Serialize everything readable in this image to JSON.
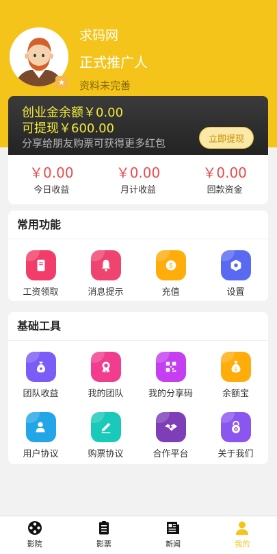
{
  "profile": {
    "site_name": "求码网",
    "role": "正式推广人",
    "note": "资料未完善"
  },
  "balance": {
    "line1": "创业金余额￥0.00",
    "line2": "可提现￥600.00",
    "note": "分享给朋友购票可获得更多红包",
    "withdraw_label": "立即提现"
  },
  "earnings": [
    {
      "value": "￥0.00",
      "label": "今日收益"
    },
    {
      "value": "￥0.00",
      "label": "月计收益"
    },
    {
      "value": "￥0.00",
      "label": "回款资金"
    }
  ],
  "common": {
    "title": "常用功能",
    "items": [
      {
        "label": "工资领取",
        "icon": "envelope-icon",
        "color": "#f23d6a"
      },
      {
        "label": "消息提示",
        "icon": "bell-icon",
        "color": "#f04470"
      },
      {
        "label": "充值",
        "icon": "coin-icon",
        "color": "#ffad0a"
      },
      {
        "label": "设置",
        "icon": "gear-icon",
        "color": "#5969f2"
      }
    ]
  },
  "tools": {
    "title": "基础工具",
    "items": [
      {
        "label": "团队收益",
        "icon": "money-bag-icon",
        "color": "#7b5cf6"
      },
      {
        "label": "我的团队",
        "icon": "ribbon-icon",
        "color": "#f23c8e"
      },
      {
        "label": "我的分享码",
        "icon": "qr-code-icon",
        "color": "#c53ef2"
      },
      {
        "label": "余额宝",
        "icon": "money-bag-icon",
        "color": "#ffad0a"
      },
      {
        "label": "用户协议",
        "icon": "user-icon",
        "color": "#23a6e8"
      },
      {
        "label": "购票协议",
        "icon": "pencil-icon",
        "color": "#19c9b9"
      },
      {
        "label": "合作平台",
        "icon": "handshake-icon",
        "color": "#7e3eb8"
      },
      {
        "label": "关于我们",
        "icon": "lock-eye-icon",
        "color": "#8b55f0"
      }
    ]
  },
  "tabbar": [
    {
      "label": "影院",
      "icon": "film-reel-icon",
      "active": false
    },
    {
      "label": "影票",
      "icon": "clipboard-icon",
      "active": false
    },
    {
      "label": "新闻",
      "icon": "newspaper-icon",
      "active": false
    },
    {
      "label": "我的",
      "icon": "person-icon",
      "active": true
    }
  ],
  "colors": {
    "brand_yellow": "#f4c41a",
    "balance_text": "#f2ea3c",
    "earnings_red": "#e84c4c"
  }
}
